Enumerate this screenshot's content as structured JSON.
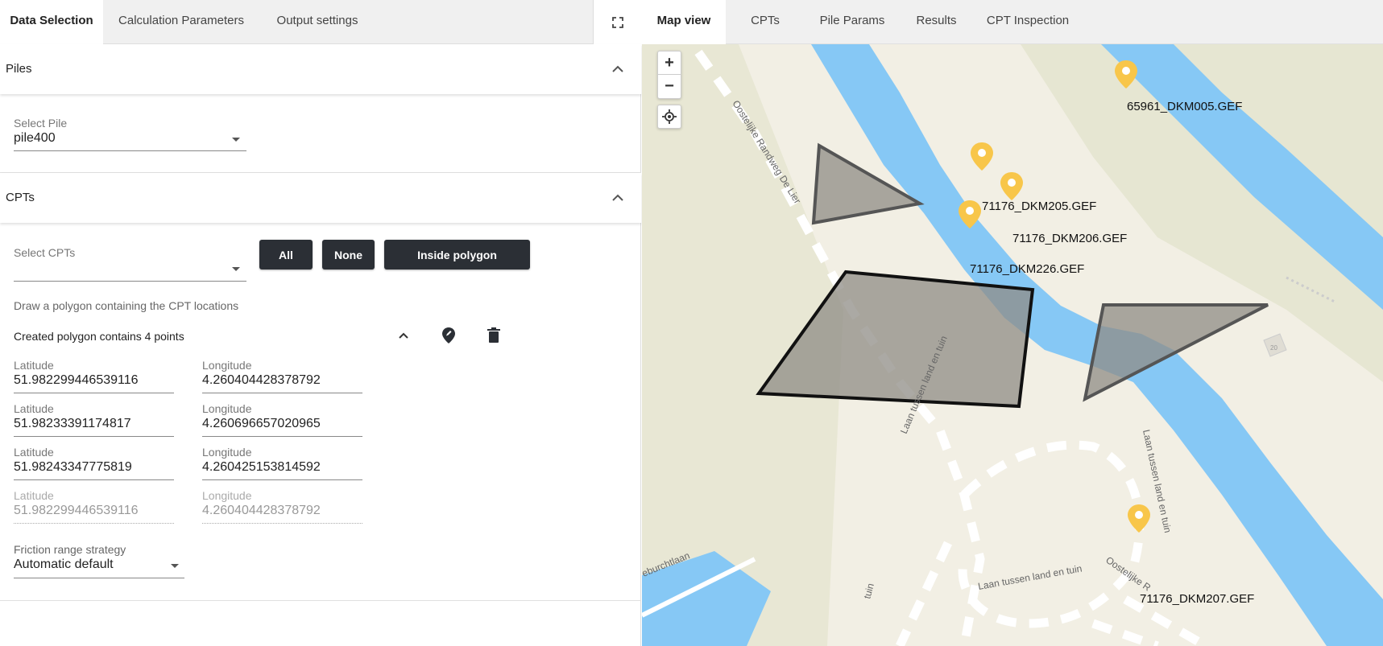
{
  "left_tabs": [
    {
      "label": "Data Selection"
    },
    {
      "label": "Calculation Parameters"
    },
    {
      "label": "Output settings"
    }
  ],
  "right_tabs": [
    {
      "label": "Map view"
    },
    {
      "label": "CPTs"
    },
    {
      "label": "Pile Params"
    },
    {
      "label": "Results"
    },
    {
      "label": "CPT Inspection"
    }
  ],
  "piles": {
    "title": "Piles",
    "select_label": "Select Pile",
    "select_value": "pile400"
  },
  "cpts": {
    "title": "CPTs",
    "select_label": "Select CPTs",
    "select_value": "",
    "buttons": {
      "all": "All",
      "none": "None",
      "inside": "Inside polygon"
    },
    "hint": "Draw a polygon containing the CPT locations",
    "polygon_summary": "Created polygon contains 4 points",
    "points": [
      {
        "lat_label": "Latitude",
        "lat": "51.982299446539116",
        "lon_label": "Longitude",
        "lon": "4.260404428378792"
      },
      {
        "lat_label": "Latitude",
        "lat": "51.98233391174817",
        "lon_label": "Longitude",
        "lon": "4.260696657020965"
      },
      {
        "lat_label": "Latitude",
        "lat": "51.98243347775819",
        "lon_label": "Longitude",
        "lon": "4.260425153814592"
      },
      {
        "lat_label": "Latitude",
        "lat": "51.982299446539116",
        "lon_label": "Longitude",
        "lon": "4.260404428378792"
      }
    ],
    "friction_label": "Friction range strategy",
    "friction_value": "Automatic default"
  },
  "map": {
    "zoom_in": "+",
    "zoom_out": "−",
    "markers": [
      {
        "label": "65961_DKM005.GEF"
      },
      {
        "label": "71176_DKM205.GEF"
      },
      {
        "label": "71176_DKM206.GEF"
      },
      {
        "label": "71176_DKM226.GEF"
      },
      {
        "label": "71176_DKM207.GEF"
      }
    ],
    "streets": [
      {
        "label": "Oostelijke Randweg De Lier"
      },
      {
        "label": "Laan tussen land en tuin"
      },
      {
        "label": "Laan tussen land en tuin"
      },
      {
        "label": "Laan tussen land en tuin"
      },
      {
        "label": "eburchtlaan"
      },
      {
        "label": "Oostelijke R"
      },
      {
        "label": "tuin"
      }
    ],
    "building_number": "20"
  },
  "colors": {
    "water": "#86c8f5",
    "land": "#f2efe4",
    "green": "#e4e6d0",
    "polygon": "#8f8c86",
    "marker": "#f8c64a",
    "button": "#2b2f35"
  }
}
